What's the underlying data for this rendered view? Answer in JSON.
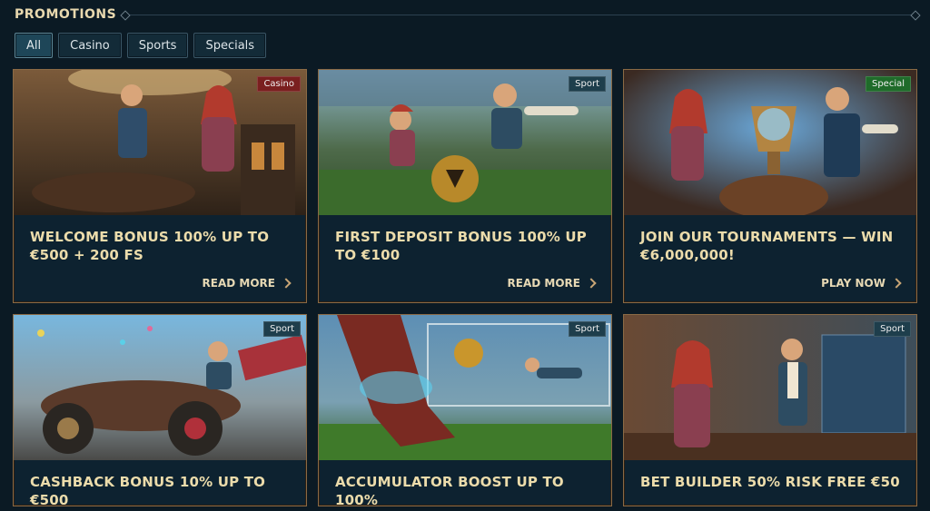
{
  "page": {
    "title": "PROMOTIONS"
  },
  "filters": [
    {
      "label": "All",
      "active": true
    },
    {
      "label": "Casino",
      "active": false
    },
    {
      "label": "Sports",
      "active": false
    },
    {
      "label": "Specials",
      "active": false
    }
  ],
  "colors": {
    "badge_casino": "#7a1f1f",
    "badge_sport": "#1e3e4c",
    "badge_special": "#1f6b2a",
    "title_gold": "#ecdcab"
  },
  "cards": [
    {
      "badge": "Casino",
      "title": "WELCOME BONUS 100% UP TO €500 + 200 FS",
      "cta": "READ MORE"
    },
    {
      "badge": "Sport",
      "title": "FIRST DEPOSIT BONUS 100% UP TO €100",
      "cta": "READ MORE"
    },
    {
      "badge": "Special",
      "title": "JOIN OUR TOURNAMENTS — WIN €6,000,000!",
      "cta": "PLAY NOW"
    },
    {
      "badge": "Sport",
      "title": "CASHBACK BONUS 10% UP TO €500",
      "cta": ""
    },
    {
      "badge": "Sport",
      "title": "ACCUMULATOR BOOST UP TO 100%",
      "cta": ""
    },
    {
      "badge": "Sport",
      "title": "BET BUILDER 50% RISK FREE €50",
      "cta": ""
    }
  ]
}
